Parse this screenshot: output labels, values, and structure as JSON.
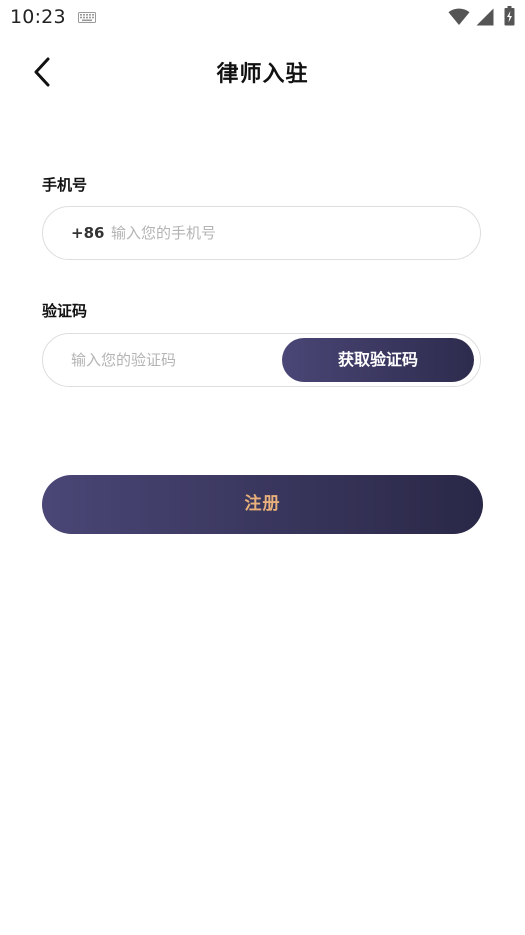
{
  "status_bar": {
    "time": "10:23",
    "icons": [
      "keyboard-icon",
      "wifi-icon",
      "signal-icon",
      "battery-icon"
    ]
  },
  "header": {
    "title": "律师入驻",
    "back_icon": "chevron-left-icon"
  },
  "form": {
    "phone": {
      "label": "手机号",
      "country_code": "+86",
      "placeholder": "输入您的手机号",
      "value": ""
    },
    "code": {
      "label": "验证码",
      "placeholder": "输入您的验证码",
      "value": "",
      "get_code_label": "获取验证码"
    },
    "register_label": "注册"
  },
  "colors": {
    "button_gradient_start": "#4a4676",
    "button_gradient_end": "#2d2b4d",
    "register_text": "#e8b07a",
    "border": "#dedede",
    "placeholder": "#b4b4b4"
  }
}
